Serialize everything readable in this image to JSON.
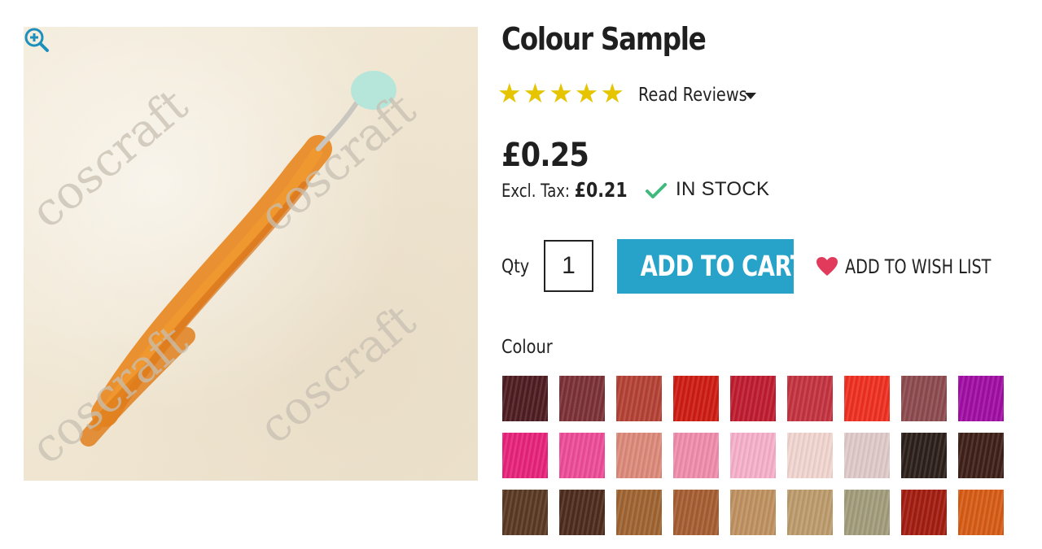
{
  "product": {
    "title": "Colour Sample",
    "image_watermark": "coscraft",
    "rating": 5,
    "read_reviews": "Read Reviews",
    "price": "£0.25",
    "excl_tax_label": "Excl. Tax:",
    "excl_tax_price": "£0.21",
    "stock_status": "IN STOCK",
    "qty_label": "Qty",
    "qty_value": "1",
    "add_to_cart": "ADD TO CART",
    "add_to_wishlist": "ADD TO WISH LIST",
    "colour_label": "Colour"
  },
  "colors": {
    "accent": "#27a3c9",
    "star": "#e7c400",
    "check": "#3fba7c",
    "heart": "#e23a5a",
    "zoom": "#1d8fbd",
    "hair_sample": "#e8861f"
  },
  "swatches": [
    [
      "#4e1d22",
      "#7c3137",
      "#b54235",
      "#cf1c13",
      "#c01c30",
      "#c43340",
      "#ef3022",
      "#8d4b4f",
      "#a10ea4"
    ],
    [
      "#e8237b",
      "#ee4c98",
      "#dd8a7a",
      "#f08dac",
      "#f7b0cb",
      "#f2d6d0",
      "#e0cbc9",
      "#2d201b",
      "#3f2019"
    ],
    [
      "#5a3a24",
      "#4e2c1d",
      "#a06432",
      "#a65e32",
      "#c09261",
      "#bd9c6d",
      "#a39d7c",
      "#a31d10",
      "#d75c15"
    ]
  ]
}
